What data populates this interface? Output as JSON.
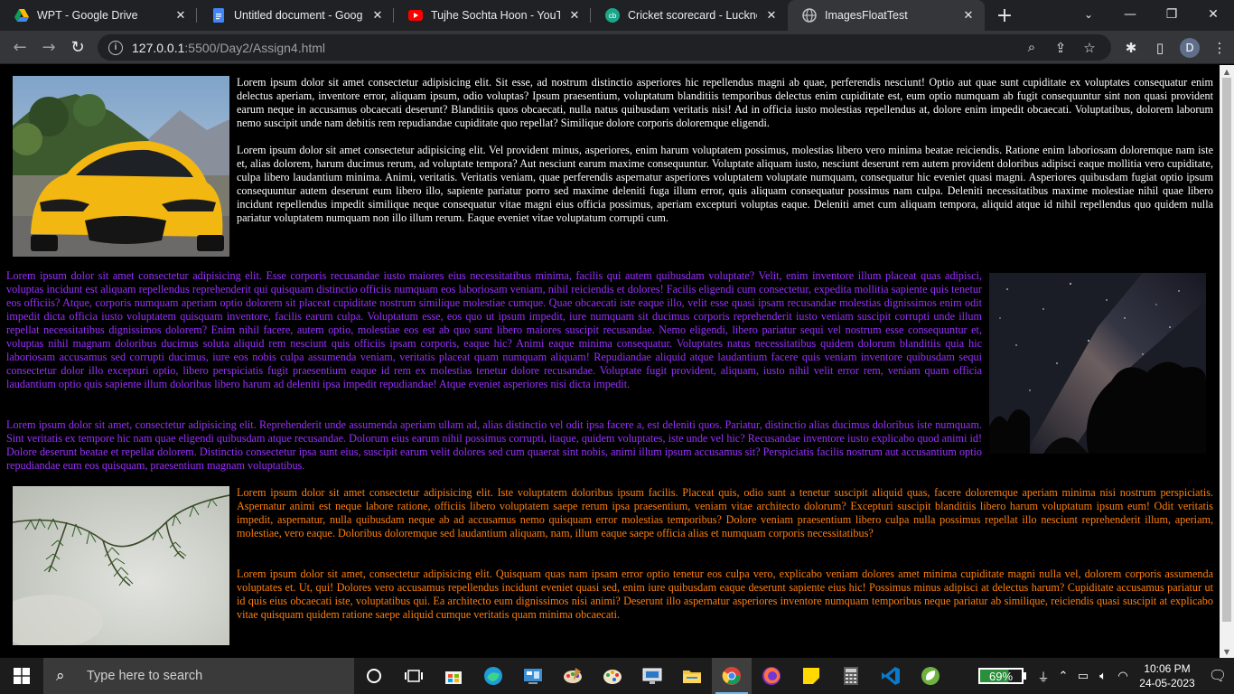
{
  "tabs": [
    {
      "title": "WPT - Google Drive",
      "icon": "google-drive-icon",
      "active": false
    },
    {
      "title": "Untitled document - Google",
      "icon": "google-docs-icon",
      "active": false
    },
    {
      "title": "Tujhe Sochta Hoon - YouTube",
      "icon": "youtube-icon",
      "active": false
    },
    {
      "title": "Cricket scorecard - Lucknow",
      "icon": "cricbuzz-icon",
      "active": false
    },
    {
      "title": "ImagesFloatTest",
      "icon": "globe-icon",
      "active": true
    }
  ],
  "address": {
    "host": "127.0.0.1",
    "path": ":5500/Day2/Assign4.html"
  },
  "profile_initial": "D",
  "colors": {
    "section1_text": "#ffffff",
    "section2_text": "#9b30ff",
    "section3_text": "#ff7f0e",
    "background": "#000000"
  },
  "section1": {
    "image": "yellow-sports-car-image",
    "paragraphs": [
      "Lorem ipsum dolor sit amet consectetur adipisicing elit. Sit esse, ad nostrum distinctio asperiores hic repellendus magni ab quae, perferendis nesciunt! Optio aut quae sunt cupiditate ex voluptates consequatur enim delectus aperiam, inventore error, aliquam ipsum, odio voluptas? Ipsum praesentium, voluptatum blanditiis temporibus delectus enim cupiditate est, eum optio numquam ab fugit consequuntur sint non quasi provident earum neque in accusamus obcaecati deserunt? Blanditiis quos obcaecati, nulla natus quibusdam veritatis nisi! Ad in officia iusto molestias repellendus at, dolore enim impedit obcaecati. Voluptatibus, dolorem laborum nemo suscipit unde nam debitis rem repudiandae cupiditate quo repellat? Similique dolore corporis doloremque eligendi.",
      "Lorem ipsum dolor sit amet consectetur adipisicing elit. Vel provident minus, asperiores, enim harum voluptatem possimus, molestias libero vero minima beatae reiciendis. Ratione enim laboriosam doloremque nam iste et, alias dolorem, harum ducimus rerum, ad voluptate tempora? Aut nesciunt earum maxime consequuntur. Voluptate aliquam iusto, nesciunt deserunt rem autem provident doloribus adipisci eaque mollitia vero cupiditate, culpa libero laudantium minima. Animi, veritatis. Veritatis veniam, quae perferendis aspernatur asperiores voluptatem voluptate numquam, consequatur hic eveniet quasi magni. Asperiores quibusdam fugiat optio ipsum consequuntur autem deserunt eum libero illo, sapiente pariatur porro sed maxime deleniti fuga illum error, quis aliquam consequatur possimus nam culpa. Deleniti necessitatibus maxime molestiae nihil quae libero incidunt repellendus impedit similique neque consequatur vitae magni eius officia possimus, aperiam excepturi voluptas eaque. Deleniti amet cum aliquam tempora, aliquid atque id nihil repellendus quo quidem nulla pariatur voluptatem numquam non illo illum rerum. Eaque eveniet vitae voluptatum corrupti cum."
    ]
  },
  "section2": {
    "image": "milky-way-night-sky-image",
    "paragraphs": [
      "Lorem ipsum dolor sit amet consectetur adipisicing elit. Esse corporis recusandae iusto maiores eius necessitatibus minima, facilis qui autem quibusdam voluptate? Velit, enim inventore illum placeat quas adipisci, voluptas incidunt est aliquam repellendus reprehenderit qui quisquam distinctio officiis numquam eos laboriosam veniam, nihil reiciendis et dolores! Facilis eligendi cum consectetur, expedita mollitia sapiente quis tenetur eos officiis? Atque, corporis numquam aperiam optio dolorem sit placeat cupiditate nostrum similique molestiae cumque. Quae obcaecati iste eaque illo, velit esse quasi ipsam recusandae molestias dignissimos enim odit impedit dicta officia iusto voluptatem quisquam inventore, facilis earum culpa. Voluptatum esse, eos quo ut ipsum impedit, iure numquam sit ducimus corporis reprehenderit iusto veniam suscipit corrupti unde illum repellat necessitatibus dignissimos dolorem? Enim nihil facere, autem optio, molestiae eos est ab quo sunt libero maiores suscipit recusandae. Nemo eligendi, libero pariatur sequi vel nostrum esse consequuntur et, voluptas nihil magnam doloribus ducimus soluta aliquid rem nesciunt quis officiis ipsam corporis, eaque hic? Animi eaque minima consequatur. Voluptates natus necessitatibus quidem dolorum blanditiis quia hic laboriosam accusamus sed corrupti ducimus, iure eos nobis culpa assumenda veniam, veritatis placeat quam numquam aliquam! Repudiandae aliquid atque laudantium facere quis veniam inventore quibusdam sequi consectetur dolor illo excepturi optio, libero perspiciatis fugit praesentium eaque id rem ex molestias tenetur dolore recusandae. Voluptate fugit provident, aliquam, iusto nihil velit error rem, veniam quam officia laudantium optio quis sapiente illum doloribus libero harum ad deleniti ipsa impedit repudiandae! Atque eveniet asperiores nisi dicta impedit.",
      "Lorem ipsum dolor sit amet, consectetur adipisicing elit. Reprehenderit unde assumenda aperiam ullam ad, alias distinctio vel odit ipsa facere a, est deleniti quos. Pariatur, distinctio alias ducimus doloribus iste numquam. Sint veritatis ex tempore hic nam quae eligendi quibusdam atque recusandae. Dolorum eius earum nihil possimus corrupti, itaque, quidem voluptates, iste unde vel hic? Recusandae inventore iusto explicabo quod animi id! Dolore deserunt beatae et repellat dolorem. Distinctio consectetur ipsa sunt eius, suscipit earum velit dolores sed cum quaerat sint nobis, animi illum ipsum accusamus sit? Perspiciatis facilis nostrum aut accusantium optio repudiandae eum eos quisquam, praesentium magnam voluptatibus."
    ]
  },
  "section3": {
    "image": "pine-branch-image",
    "paragraphs": [
      "Lorem ipsum dolor sit amet consectetur adipisicing elit. Iste voluptatem doloribus ipsum facilis. Placeat quis, odio sunt a tenetur suscipit aliquid quas, facere doloremque aperiam minima nisi nostrum perspiciatis. Aspernatur animi est neque labore ratione, officiis libero voluptatem saepe rerum ipsa praesentium, veniam vitae architecto dolorum? Excepturi suscipit blanditiis libero harum voluptatum ipsum eum! Odit veritatis impedit, aspernatur, nulla quibusdam neque ab ad accusamus nemo quisquam error molestias temporibus? Dolore veniam praesentium libero culpa nulla possimus repellat illo nesciunt reprehenderit illum, aperiam, molestiae, vero eaque. Doloribus doloremque sed laudantium aliquam, nam, illum eaque saepe officia alias et numquam corporis necessitatibus?",
      "Lorem ipsum dolor sit amet, consectetur adipisicing elit. Quisquam quas nam ipsam error optio tenetur eos culpa vero, explicabo veniam dolores amet minima cupiditate magni nulla vel, dolorem corporis assumenda voluptates et. Ut, qui! Dolores vero accusamus repellendus incidunt eveniet quasi sed, enim iure quibusdam eaque deserunt sapiente eius hic! Possimus minus adipisci at delectus harum? Cupiditate accusamus pariatur ut id quis eius obcaecati iste, voluptatibus qui. Ea architecto eum dignissimos nisi animi? Deserunt illo aspernatur asperiores inventore numquam temporibus neque pariatur ab similique, reiciendis quasi suscipit at explicabo vitae quisquam quidem ratione saepe aliquid cumque veritatis quam minima obcaecati."
    ]
  },
  "taskbar": {
    "search_placeholder": "Type here to search",
    "battery_percent": "69%",
    "battery_level": 0.69,
    "time": "10:06 PM",
    "date": "24-05-2023"
  }
}
